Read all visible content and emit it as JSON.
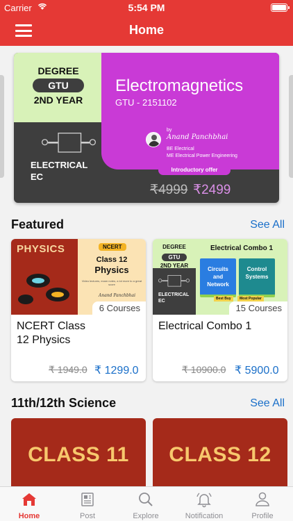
{
  "status_bar": {
    "carrier": "Carrier",
    "time": "5:54 PM"
  },
  "navbar": {
    "title": "Home",
    "menu_icon": "hamburger-menu-icon"
  },
  "banner": {
    "degree": "DEGREE",
    "university": "GTU",
    "year": "2ND YEAR",
    "branch_line1": "ELECTRICAL",
    "branch_line2": "EC",
    "course_title": "Electromagnetics",
    "course_code": "GTU - 2151102",
    "by": "by",
    "author": "Anand Panchbhai",
    "cred_line1": "BE Electrical",
    "cred_line2": "ME Electrical Power Engineering",
    "offer": "Introductory offer",
    "old_price": "₹4999",
    "new_price": "₹2499",
    "colors": {
      "purple": "#c93ad6",
      "dark": "#3e3e3e",
      "green": "#d8f2b8"
    }
  },
  "featured": {
    "title": "Featured",
    "see_all": "See All",
    "cards": [
      {
        "thumb": {
          "subject_banner": "PHYSICS",
          "badge": "NCERT",
          "class_line": "Class 12",
          "subject": "Physics",
          "desc": "Video lectures, exam notes, a lot more to a great score",
          "author": "Anand Panchbhai"
        },
        "count": "6 Courses",
        "name_line1": "NCERT Class",
        "name_line2": "12 Physics",
        "old_price": "₹ 1949.0",
        "price": "₹ 1299.0"
      },
      {
        "thumb": {
          "degree": "DEGREE",
          "university": "GTU",
          "year": "2ND YEAR",
          "branch_line1": "ELECTRICAL",
          "branch_line2": "EC",
          "combo_title": "Electrical Combo 1",
          "book1_line1": "Circuits",
          "book1_line2": "and",
          "book1_line3": "Network",
          "book2_line1": "Control",
          "book2_line2": "Systems",
          "tag1": "Best Buy",
          "tag2": "Most Popular"
        },
        "count": "15 Courses",
        "name_line1": "Electrical Combo 1",
        "old_price": "₹ 10900.0",
        "price": "₹ 5900.0"
      }
    ]
  },
  "science": {
    "title": "11th/12th Science",
    "see_all": "See All",
    "tiles": [
      {
        "label": "CLASS 11"
      },
      {
        "label": "CLASS 12"
      }
    ]
  },
  "tabbar": {
    "tabs": [
      {
        "label": "Home",
        "icon": "home-icon",
        "active": true
      },
      {
        "label": "Post",
        "icon": "newspaper-icon"
      },
      {
        "label": "Explore",
        "icon": "search-icon"
      },
      {
        "label": "Notification",
        "icon": "bell-icon"
      },
      {
        "label": "Profile",
        "icon": "person-icon"
      }
    ],
    "active_color": "#e53935",
    "inactive_color": "#8e8e93"
  }
}
